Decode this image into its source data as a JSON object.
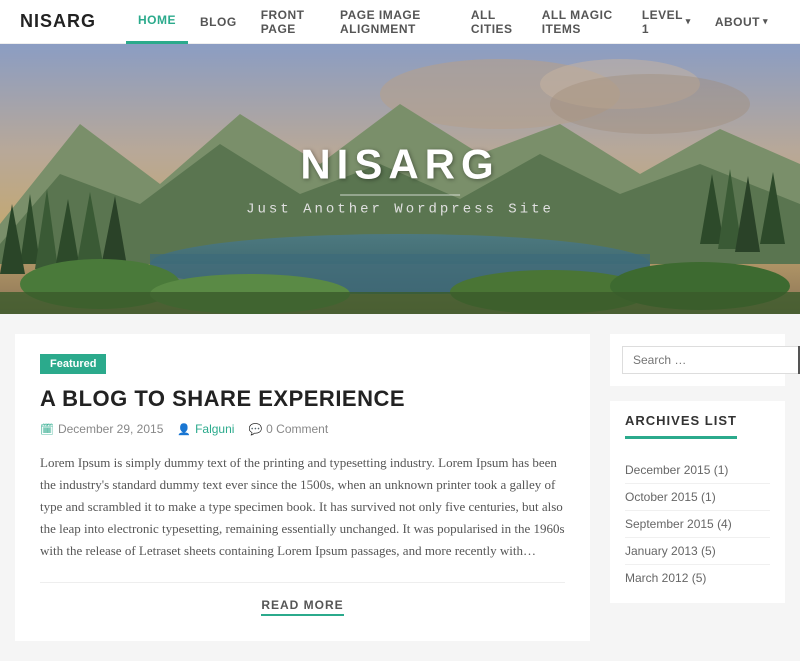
{
  "header": {
    "logo": "NISARG",
    "nav": [
      {
        "label": "HOME",
        "active": true,
        "has_arrow": false
      },
      {
        "label": "BLOG",
        "active": false,
        "has_arrow": false
      },
      {
        "label": "FRONT PAGE",
        "active": false,
        "has_arrow": false
      },
      {
        "label": "PAGE IMAGE ALIGNMENT",
        "active": false,
        "has_arrow": false
      },
      {
        "label": "ALL CITIES",
        "active": false,
        "has_arrow": false
      },
      {
        "label": "ALL MAGIC ITEMS",
        "active": false,
        "has_arrow": false
      },
      {
        "label": "LEVEL 1",
        "active": false,
        "has_arrow": true
      },
      {
        "label": "ABOUT",
        "active": false,
        "has_arrow": true
      }
    ]
  },
  "hero": {
    "title": "NISARG",
    "subtitle": "Just Another Wordpress Site"
  },
  "article": {
    "badge": "Featured",
    "title": "A BLOG TO SHARE EXPERIENCE",
    "meta": {
      "date": "December 29, 2015",
      "author": "Falguni",
      "comments": "0 Comment"
    },
    "content": "Lorem Ipsum is simply dummy text of the printing and typesetting industry. Lorem Ipsum has been the industry's standard dummy text ever since the 1500s, when an unknown printer took a galley of type and scrambled it to make a type specimen book. It has survived not only five centuries, but also the leap into electronic typesetting, remaining essentially unchanged. It was popularised in the 1960s with the release of Letraset sheets containing Lorem Ipsum passages, and more recently with…",
    "read_more": "READ MORE"
  },
  "sidebar": {
    "search": {
      "placeholder": "Search …"
    },
    "archives": {
      "title": "ARCHIVES LIST",
      "items": [
        {
          "label": "December 2015",
          "count": "(1)"
        },
        {
          "label": "October 2015",
          "count": "(1)"
        },
        {
          "label": "September 2015",
          "count": "(4)"
        },
        {
          "label": "January 2013",
          "count": "(5)"
        },
        {
          "label": "March 2012",
          "count": "(5)"
        }
      ]
    }
  },
  "colors": {
    "accent": "#2baa8c"
  }
}
